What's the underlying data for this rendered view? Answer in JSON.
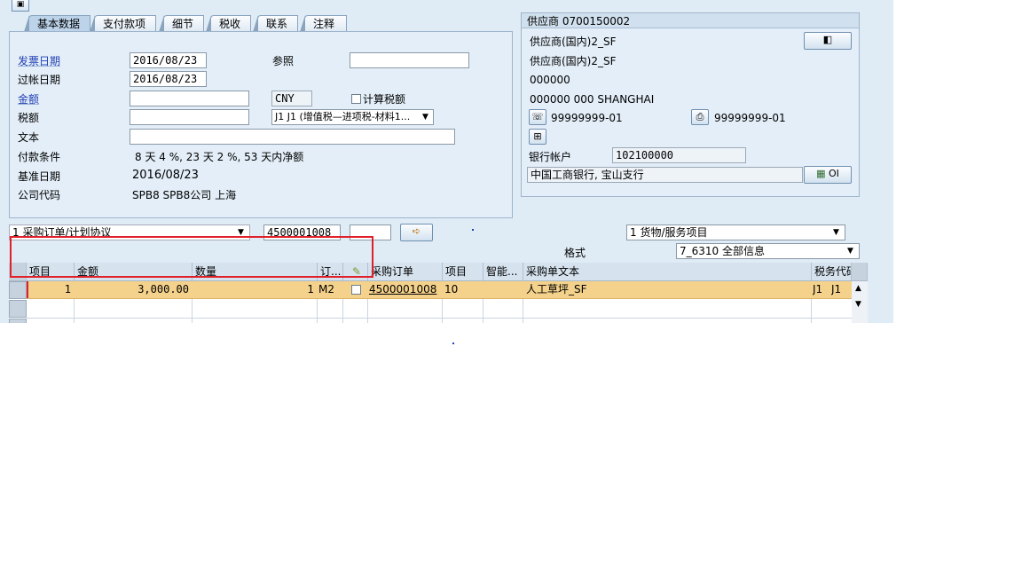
{
  "toolbar": {
    "doc_icon": "document-icon"
  },
  "tabs": [
    "基本数据",
    "支付款项",
    "细节",
    "税收",
    "联系",
    "注释"
  ],
  "basic": {
    "invoice_date_label": "发票日期",
    "invoice_date": "2016/08/23",
    "reference_label": "参照",
    "reference_value": "",
    "posting_date_label": "过帐日期",
    "posting_date": "2016/08/23",
    "amount_label": "金额",
    "amount_value": "",
    "currency": "CNY",
    "calc_tax_label": "计算税额",
    "tax_label": "税额",
    "tax_value": "",
    "tax_code": "J1 J1 (增值税—进项税-材料1...",
    "text_label": "文本",
    "text_value": "",
    "payment_terms_label": "付款条件",
    "payment_terms_value": "8 天 4 %, 23 天 2 %, 53 天内净额",
    "baseline_date_label": "基准日期",
    "baseline_date": "2016/08/23",
    "company_code_label": "公司代码",
    "company_code_value": "SPB8 SPB8公司 上海"
  },
  "vendor": {
    "title": "供应商 0700150002",
    "line1": "供应商(国内)2_SF",
    "line2": "供应商(国内)2_SF",
    "line3": "000000",
    "line4": "000000 000 SHANGHAI",
    "phone": "99999999-01",
    "fax": "99999999-01",
    "bank_account_label": "银行帐户",
    "bank_account": "102100000",
    "bank_name": "中国工商银行, 宝山支行",
    "oi_label": "OI"
  },
  "reference_row": {
    "doc_type": "1 采购订单/计划协议",
    "po_number": "4500001008",
    "po_item": "",
    "item_type": "1 货物/服务项目",
    "layout_label": "格式",
    "layout_value": "7_6310 全部信息"
  },
  "table": {
    "headers": [
      "项目",
      "金额",
      "数量",
      "订...",
      "",
      "采购订单",
      "项目",
      "智能...",
      "采购单文本",
      "税务代码"
    ],
    "rows": [
      {
        "item": "1",
        "amount": "3,000.00",
        "qty": "1",
        "unit": "M2",
        "po": "4500001008",
        "po_item": "10",
        "smart": "",
        "text": "人工草坪_SF",
        "tax": "J1",
        "tax2": "J1"
      }
    ]
  },
  "colors": {
    "highlight_row": "#f5d28b",
    "annotation_box": "#e0202a",
    "label_blue": "#1f3fb3"
  }
}
